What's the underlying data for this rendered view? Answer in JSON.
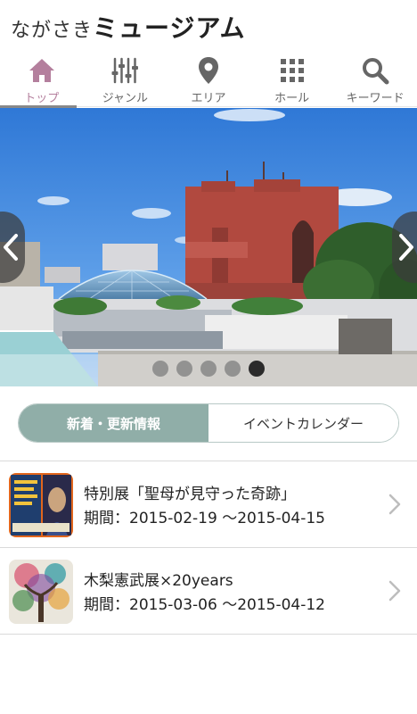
{
  "header": {
    "logo_light": "ながさき",
    "logo_bold": "ミュージアム"
  },
  "nav": {
    "items": [
      {
        "label": "トップ",
        "icon": "home-icon",
        "active": true
      },
      {
        "label": "ジャンル",
        "icon": "sliders-icon",
        "active": false
      },
      {
        "label": "エリア",
        "icon": "map-pin-icon",
        "active": false
      },
      {
        "label": "ホール",
        "icon": "grid-icon",
        "active": false
      },
      {
        "label": "キーワード",
        "icon": "search-icon",
        "active": false
      }
    ],
    "active_color": "#b47f9d"
  },
  "carousel": {
    "slide_count": 5,
    "active_index": 4
  },
  "segment": {
    "left_label": "新着・更新情報",
    "right_label": "イベントカレンダー",
    "active": "left",
    "accent_color": "#90aea8"
  },
  "events": [
    {
      "title": "特別展「聖母が見守った奇跡」",
      "period": "期間：2015-02-19 〜2015-04-15"
    },
    {
      "title": "木梨憲武展×20years",
      "period": "期間：2015-03-06 〜2015-04-12"
    }
  ]
}
